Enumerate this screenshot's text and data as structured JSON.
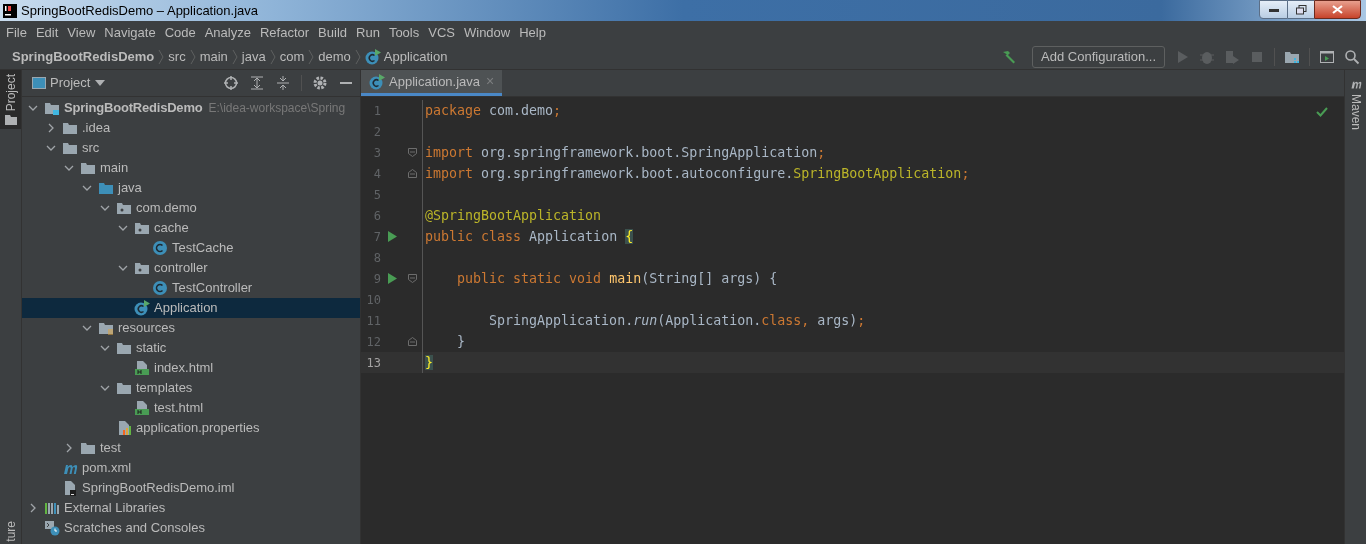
{
  "window": {
    "title": "SpringBootRedisDemo – Application.java"
  },
  "menu": [
    "File",
    "Edit",
    "View",
    "Navigate",
    "Code",
    "Analyze",
    "Refactor",
    "Build",
    "Run",
    "Tools",
    "VCS",
    "Window",
    "Help"
  ],
  "breadcrumbs": [
    {
      "label": "SpringBootRedisDemo",
      "kind": "project"
    },
    {
      "label": "src",
      "kind": "dir"
    },
    {
      "label": "main",
      "kind": "dir"
    },
    {
      "label": "java",
      "kind": "dir"
    },
    {
      "label": "com",
      "kind": "dir"
    },
    {
      "label": "demo",
      "kind": "dir"
    },
    {
      "label": "Application",
      "kind": "main-class"
    }
  ],
  "toolbar": {
    "config_button": "Add Configuration..."
  },
  "left_strip": [
    {
      "label": "Project",
      "selected": true
    },
    {
      "label": "ture",
      "selected": false
    }
  ],
  "right_strip": [
    {
      "label": "Maven"
    }
  ],
  "project_panel": {
    "title": "Project"
  },
  "tree": [
    {
      "label": "SpringBootRedisDemo",
      "hint": "E:\\idea-workspace\\Spring",
      "kind": "module",
      "expanded": true,
      "selected": false,
      "children": [
        {
          "label": ".idea",
          "kind": "folder",
          "expanded": false,
          "selected": false
        },
        {
          "label": "src",
          "kind": "folder",
          "expanded": true,
          "selected": false,
          "children": [
            {
              "label": "main",
              "kind": "folder",
              "expanded": true,
              "selected": false,
              "children": [
                {
                  "label": "java",
                  "kind": "source",
                  "expanded": true,
                  "selected": false,
                  "children": [
                    {
                      "label": "com.demo",
                      "kind": "package",
                      "expanded": true,
                      "selected": false,
                      "children": [
                        {
                          "label": "cache",
                          "kind": "package",
                          "expanded": true,
                          "selected": false,
                          "children": [
                            {
                              "label": "TestCache",
                              "kind": "class",
                              "selected": false
                            }
                          ]
                        },
                        {
                          "label": "controller",
                          "kind": "package",
                          "expanded": true,
                          "selected": false,
                          "children": [
                            {
                              "label": "TestController",
                              "kind": "class",
                              "selected": false
                            }
                          ]
                        },
                        {
                          "label": "Application",
                          "kind": "main-class",
                          "selected": true
                        }
                      ]
                    }
                  ]
                },
                {
                  "label": "resources",
                  "kind": "resources",
                  "expanded": true,
                  "selected": false,
                  "children": [
                    {
                      "label": "static",
                      "kind": "folder",
                      "expanded": true,
                      "selected": false,
                      "children": [
                        {
                          "label": "index.html",
                          "kind": "html",
                          "selected": false
                        }
                      ]
                    },
                    {
                      "label": "templates",
                      "kind": "folder",
                      "expanded": true,
                      "selected": false,
                      "children": [
                        {
                          "label": "test.html",
                          "kind": "html",
                          "selected": false
                        }
                      ]
                    },
                    {
                      "label": "application.properties",
                      "kind": "properties",
                      "selected": false
                    }
                  ]
                }
              ]
            },
            {
              "label": "test",
              "kind": "folder",
              "expanded": false,
              "selected": false
            }
          ]
        },
        {
          "label": "pom.xml",
          "kind": "maven",
          "selected": false
        },
        {
          "label": "SpringBootRedisDemo.iml",
          "kind": "iml",
          "selected": false
        }
      ]
    },
    {
      "label": "External Libraries",
      "kind": "libraries",
      "expanded": false,
      "selected": false
    },
    {
      "label": "Scratches and Consoles",
      "kind": "scratches",
      "selected": false
    }
  ],
  "editor_tabs": [
    {
      "label": "Application.java",
      "kind": "main-class",
      "selected": true,
      "close": "×"
    }
  ],
  "code": [
    {
      "number": "1",
      "run": false,
      "current": false,
      "fold_open": false,
      "fold_close": false,
      "tokens": [
        {
          "text": "package",
          "kind": "keyword"
        },
        {
          "text": " com.demo",
          "kind": "plain"
        },
        {
          "text": ";",
          "kind": "keyword"
        }
      ]
    },
    {
      "number": "2",
      "run": false,
      "current": false,
      "fold_open": false,
      "fold_close": false
    },
    {
      "number": "3",
      "run": false,
      "current": false,
      "fold_open": true,
      "fold_close": false,
      "tokens": [
        {
          "text": "import",
          "kind": "keyword"
        },
        {
          "text": " org.springframework.boot.SpringApplication",
          "kind": "plain"
        },
        {
          "text": ";",
          "kind": "keyword"
        }
      ]
    },
    {
      "number": "4",
      "run": false,
      "current": false,
      "fold_open": false,
      "fold_close": true,
      "tokens": [
        {
          "text": "import",
          "kind": "keyword"
        },
        {
          "text": " org.springframework.boot.autoconfigure.",
          "kind": "plain"
        },
        {
          "text": "SpringBootApplication",
          "kind": "annotation"
        },
        {
          "text": ";",
          "kind": "keyword"
        }
      ]
    },
    {
      "number": "5",
      "run": false,
      "current": false,
      "fold_open": false,
      "fold_close": false
    },
    {
      "number": "6",
      "run": false,
      "current": false,
      "fold_open": false,
      "fold_close": false,
      "tokens": [
        {
          "text": "@SpringBootApplication",
          "kind": "annotation"
        }
      ]
    },
    {
      "number": "7",
      "run": true,
      "current": false,
      "fold_open": false,
      "fold_close": false,
      "tokens": [
        {
          "text": "public class ",
          "kind": "keyword"
        },
        {
          "text": "Application ",
          "kind": "plain"
        },
        {
          "text": "{",
          "kind": "brace"
        }
      ]
    },
    {
      "number": "8",
      "run": false,
      "current": false,
      "fold_open": false,
      "fold_close": false
    },
    {
      "number": "9",
      "run": true,
      "current": false,
      "fold_open": true,
      "fold_close": false,
      "tokens": [
        {
          "text": "    public static void ",
          "kind": "keyword"
        },
        {
          "text": "main",
          "kind": "method"
        },
        {
          "text": "(String[] args) {",
          "kind": "plain"
        }
      ]
    },
    {
      "number": "10",
      "run": false,
      "current": false,
      "fold_open": false,
      "fold_close": false
    },
    {
      "number": "11",
      "run": false,
      "current": false,
      "fold_open": false,
      "fold_close": false,
      "tokens": [
        {
          "text": "        SpringApplication.",
          "kind": "plain"
        },
        {
          "text": "run",
          "kind": "static-call"
        },
        {
          "text": "(Application.",
          "kind": "plain"
        },
        {
          "text": "class",
          "kind": "keyword"
        },
        {
          "text": ", ",
          "kind": "keyword"
        },
        {
          "text": "args)",
          "kind": "plain"
        },
        {
          "text": ";",
          "kind": "keyword"
        }
      ]
    },
    {
      "number": "12",
      "run": false,
      "current": false,
      "fold_open": false,
      "fold_close": true,
      "tokens": [
        {
          "text": "    }",
          "kind": "plain"
        }
      ]
    },
    {
      "number": "13",
      "run": false,
      "current": true,
      "fold_open": false,
      "fold_close": false,
      "tokens": [
        {
          "text": "}",
          "kind": "brace"
        }
      ]
    }
  ]
}
